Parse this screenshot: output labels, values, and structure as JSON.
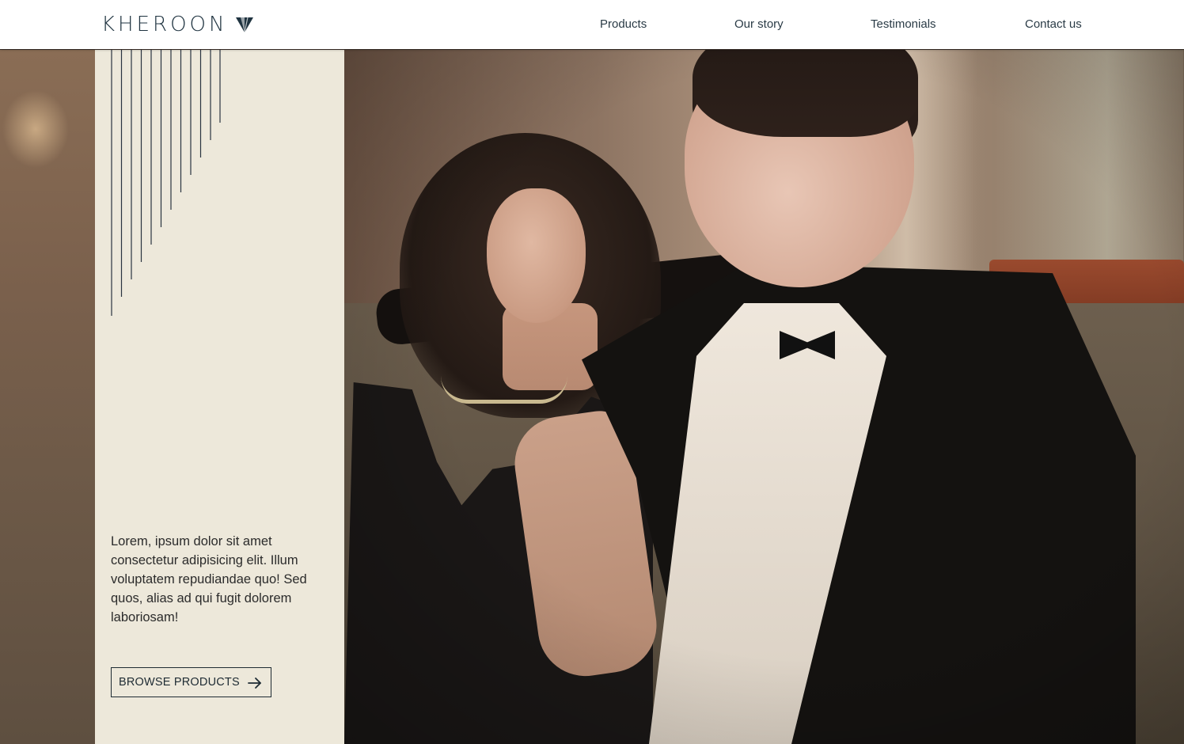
{
  "brand": {
    "name": "KHEROON",
    "logo_icon": "gem-icon"
  },
  "nav": {
    "items": [
      {
        "label": "Products"
      },
      {
        "label": "Our story"
      },
      {
        "label": "Testimonials"
      },
      {
        "label": "Contact us"
      }
    ]
  },
  "hero": {
    "text": "Lorem, ipsum dolor sit amet consectetur adipisicing elit. Illum voluptatem repudiandae quo! Sed quos, alias ad qui fugit dolorem laboriosam!",
    "button_label": "BROWSE PRODUCTS",
    "button_icon": "arrow-right-icon",
    "image": "couple-on-sofa-photo"
  },
  "colors": {
    "panel_bg": "#ede8da",
    "text_dark": "#1e2b33",
    "nav_bg": "#ffffff"
  }
}
